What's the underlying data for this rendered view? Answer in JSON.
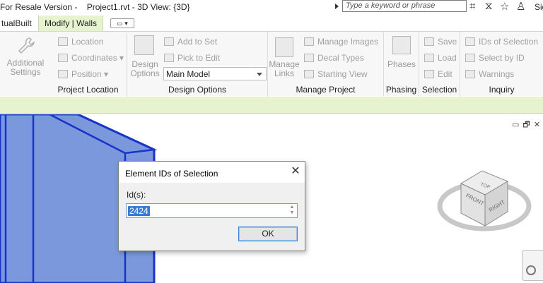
{
  "titlebar": {
    "title": "For Resale Version -    Project1.rvt - 3D View: {3D}",
    "search_placeholder": "Type a keyword or phrase",
    "signin_label": "Sig"
  },
  "tabs": {
    "virtualbuilt": "tualBuilt",
    "modify_walls": "Modify | Walls",
    "options_glyph": "▭ ▾"
  },
  "ribbon": {
    "additional_settings": "Additional Settings",
    "project_location": {
      "label": "Project Location",
      "location": "Location",
      "coordinates": "Coordinates ▾",
      "position": "Position ▾"
    },
    "design_options": {
      "label": "Design Options",
      "big_label": "Design Options",
      "add_to_set": "Add to Set",
      "pick_to_edit": "Pick to Edit",
      "selected_model": "Main Model"
    },
    "manage_project": {
      "label": "Manage Project",
      "manage_links": "Manage Links",
      "manage_images": "Manage Images",
      "decal_types": "Decal Types",
      "starting_view": "Starting View"
    },
    "phasing": {
      "label": "Phasing",
      "phases": "Phases"
    },
    "selection": {
      "label": "Selection",
      "save": "Save",
      "load": "Load",
      "edit": "Edit"
    },
    "inquiry": {
      "label": "Inquiry",
      "ids_of_selection": "IDs of Selection",
      "select_by_id": "Select by ID",
      "warnings": "Warnings"
    }
  },
  "viewport": {
    "view_controls": "▭ 🗗 ✕",
    "wall_color": "#7b98dc",
    "wall_edge_color": "#1733c8",
    "viewcube": {
      "top": "TOP",
      "front": "FRONT",
      "right": "RIGHT"
    }
  },
  "dialog": {
    "title": "Element IDs of Selection",
    "close_glyph": "✕",
    "ids_label": "Id(s):",
    "ids_value": "2424",
    "ok_label": "OK"
  }
}
